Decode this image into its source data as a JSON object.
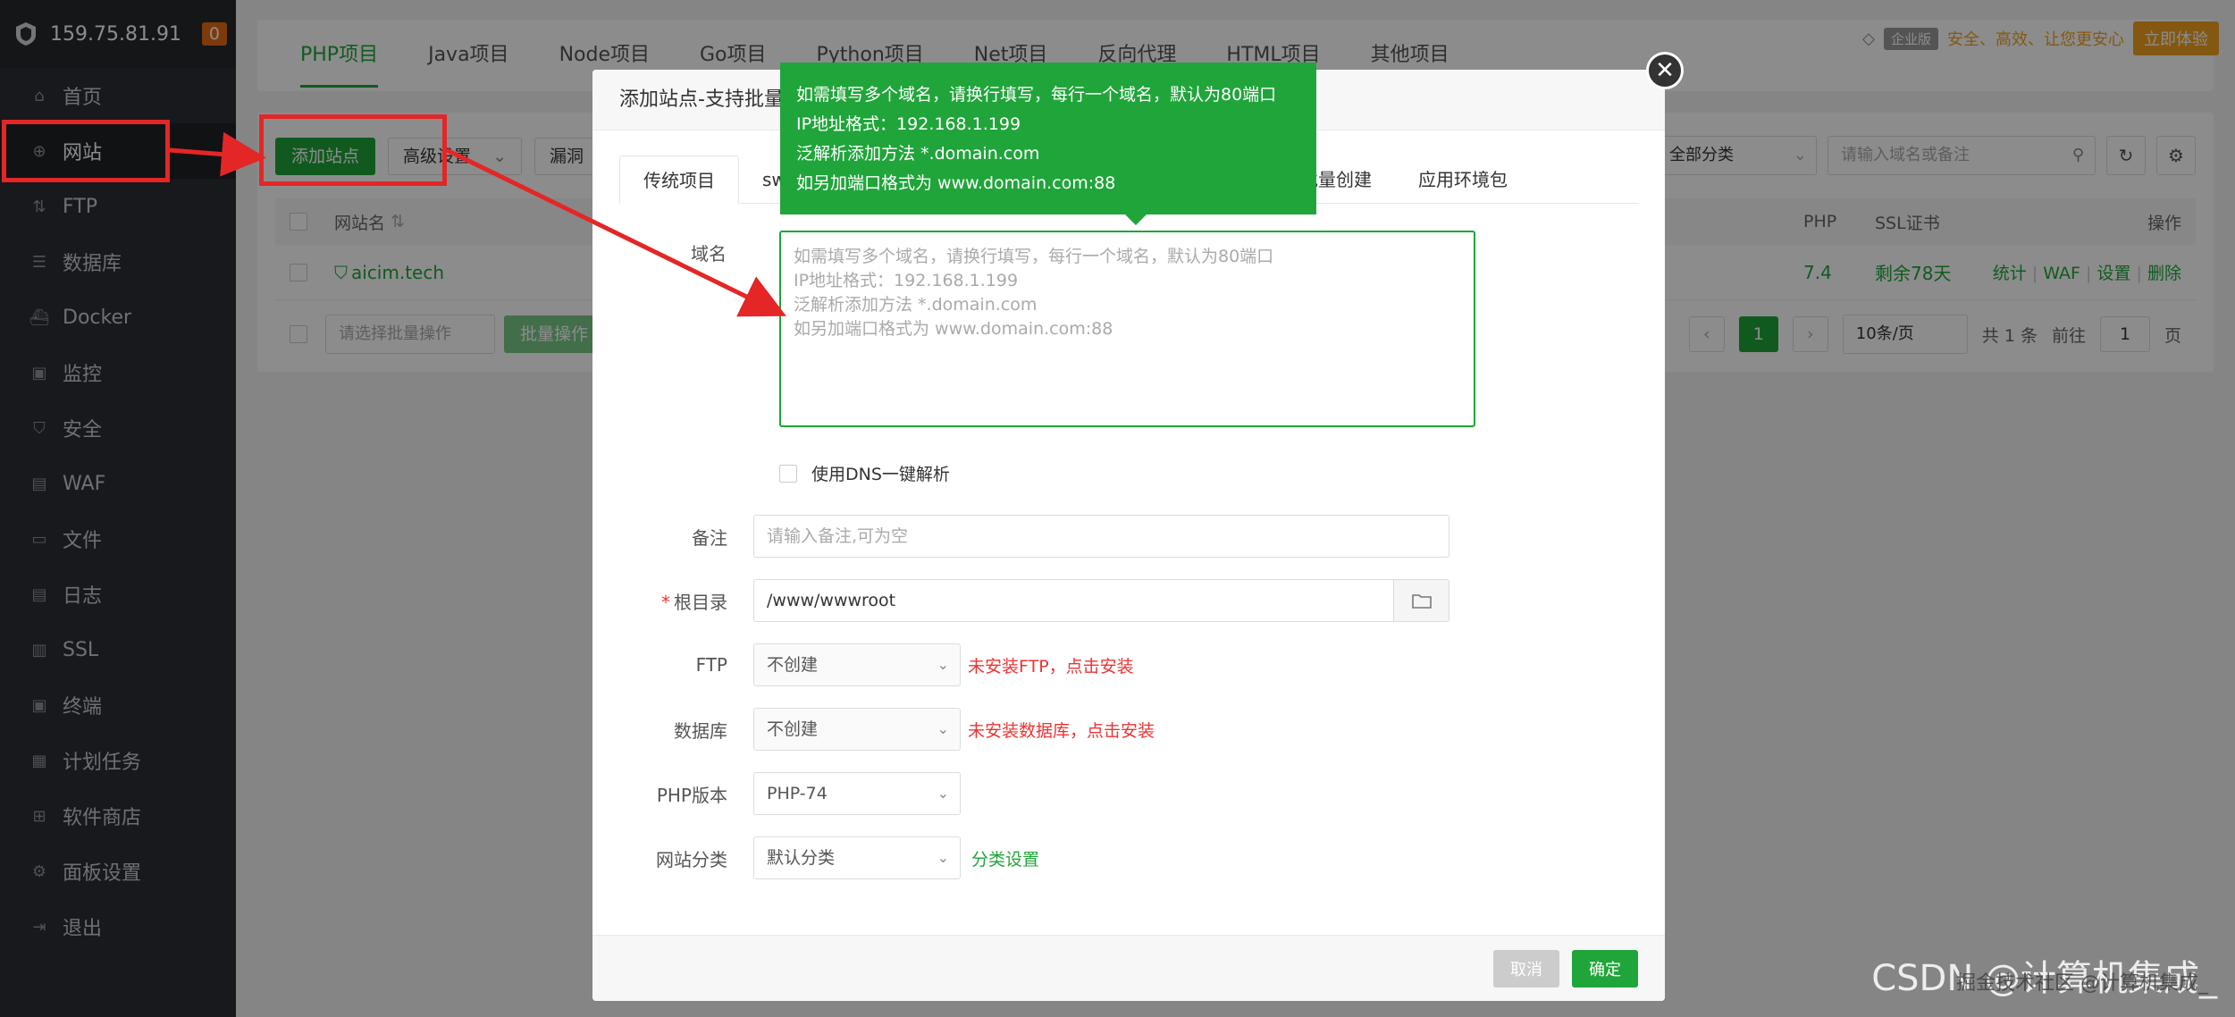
{
  "sidebar": {
    "ip": "159.75.81.91",
    "badge": "0",
    "items": [
      {
        "label": "首页",
        "icon": "home-icon"
      },
      {
        "label": "网站",
        "icon": "globe-icon"
      },
      {
        "label": "FTP",
        "icon": "ftp-icon"
      },
      {
        "label": "数据库",
        "icon": "database-icon"
      },
      {
        "label": "Docker",
        "icon": "docker-icon"
      },
      {
        "label": "监控",
        "icon": "monitor-icon"
      },
      {
        "label": "安全",
        "icon": "shield-icon"
      },
      {
        "label": "WAF",
        "icon": "waf-icon"
      },
      {
        "label": "文件",
        "icon": "folder-icon"
      },
      {
        "label": "日志",
        "icon": "log-icon"
      },
      {
        "label": "SSL",
        "icon": "ssl-icon"
      },
      {
        "label": "终端",
        "icon": "terminal-icon"
      },
      {
        "label": "计划任务",
        "icon": "calendar-icon"
      },
      {
        "label": "软件商店",
        "icon": "grid-icon"
      },
      {
        "label": "面板设置",
        "icon": "gear-icon"
      },
      {
        "label": "退出",
        "icon": "logout-icon"
      }
    ]
  },
  "top_tabs": [
    "PHP项目",
    "Java项目",
    "Node项目",
    "Go项目",
    "Python项目",
    "Net项目",
    "反向代理",
    "HTML项目",
    "其他项目"
  ],
  "top_right": {
    "enterprise": "企业版",
    "slogan": "安全、高效、让您更安心",
    "try": "立即体验"
  },
  "toolbar": {
    "add_site": "添加站点",
    "advanced": "高级设置",
    "scan": "漏洞",
    "category": "全部分类",
    "search_placeholder": "请输入域名或备注"
  },
  "table": {
    "headers": {
      "name": "网站名",
      "php": "PHP",
      "ssl": "SSL证书",
      "ops": "操作"
    },
    "row": {
      "name": "aicim.tech",
      "php": "7.4",
      "ssl": "剩余78天",
      "op1": "统计",
      "op2": "WAF",
      "op3": "设置",
      "op4": "删除"
    }
  },
  "footer": {
    "batch_placeholder": "请选择批量操作",
    "batch_btn": "批量操作",
    "page": "1",
    "per_page": "10条/页",
    "total": "共 1 条",
    "goto": "前往",
    "goto_val": "1",
    "page_unit": "页"
  },
  "modal": {
    "title": "添加站点-支持批量",
    "tabs": [
      "传统项目",
      "sw",
      "批量创建",
      "应用环境包"
    ],
    "domain_label": "域名",
    "domain_placeholder": "如需填写多个域名，请换行填写，每行一个域名，默认为80端口\nIP地址格式：192.168.1.199\n泛解析添加方法 *.domain.com\n如另加端口格式为 www.domain.com:88",
    "dns_label": "使用DNS一键解析",
    "note_label": "备注",
    "note_placeholder": "请输入备注,可为空",
    "root_label": "根目录",
    "root_value": "/www/wwwroot",
    "ftp_label": "FTP",
    "ftp_value": "不创建",
    "ftp_warn": "未安装FTP，点击安装",
    "db_label": "数据库",
    "db_value": "不创建",
    "db_warn": "未安装数据库，点击安装",
    "php_label": "PHP版本",
    "php_value": "PHP-74",
    "cat_label": "网站分类",
    "cat_value": "默认分类",
    "cat_link": "分类设置",
    "cancel": "取消",
    "ok": "确定"
  },
  "tooltip": {
    "lines": [
      "如需填写多个域名，请换行填写，每行一个域名，默认为80端口",
      "IP地址格式：192.168.1.199",
      "泛解析添加方法 *.domain.com",
      "如另加端口格式为 www.domain.com:88"
    ]
  },
  "watermark": "CSDN @计算机集成_",
  "watermark2": "掘金技术社区 @计算机集成_",
  "colors": {
    "accent": "#20a53a",
    "annotation": "#e42626",
    "sidebar": "#2b2e33"
  }
}
